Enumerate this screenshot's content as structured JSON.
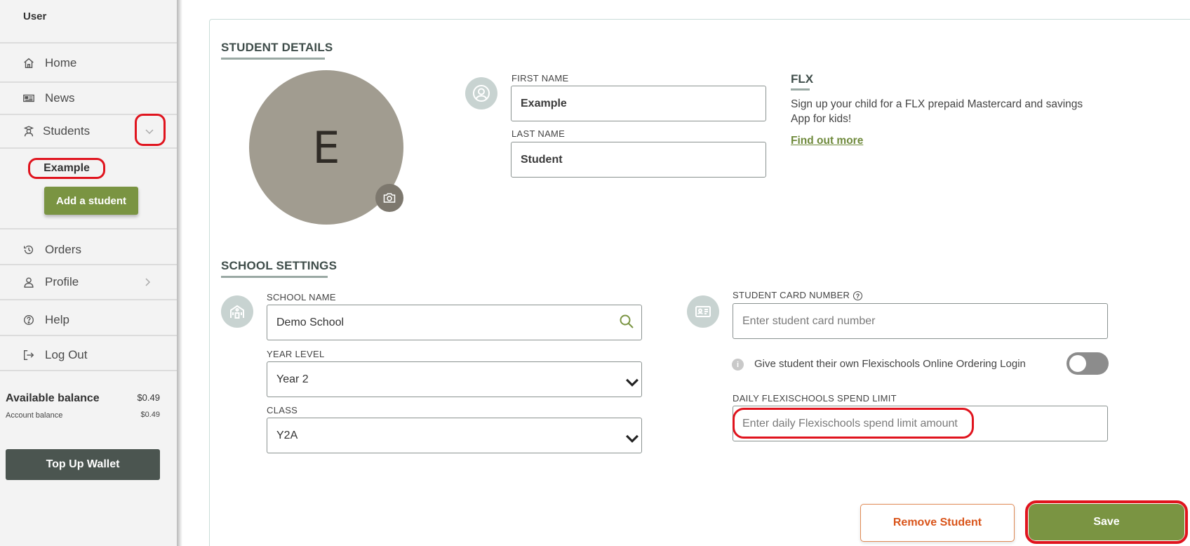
{
  "sidebar": {
    "user_label": "User",
    "items": {
      "home": "Home",
      "news": "News",
      "students": "Students",
      "orders": "Orders",
      "profile": "Profile",
      "help": "Help",
      "logout": "Log Out"
    },
    "student_entry": "Example",
    "add_student": "Add a student",
    "balance": {
      "available_label": "Available balance",
      "available_value": "$0.49",
      "account_label": "Account balance",
      "account_value": "$0.49"
    },
    "top_up": "Top Up Wallet"
  },
  "student_details": {
    "title": "STUDENT DETAILS",
    "avatar_initial": "E",
    "first_name_label": "FIRST NAME",
    "first_name_value": "Example",
    "last_name_label": "LAST NAME",
    "last_name_value": "Student"
  },
  "flx": {
    "title": "FLX",
    "description": "Sign up your child for a FLX prepaid Mastercard and savings App for kids!",
    "link": "Find out more"
  },
  "school_settings": {
    "title": "SCHOOL SETTINGS",
    "school_name_label": "SCHOOL NAME",
    "school_name_value": "Demo School",
    "year_level_label": "YEAR LEVEL",
    "year_level_value": "Year 2",
    "class_label": "CLASS",
    "class_value": "Y2A",
    "card_number_label": "STUDENT CARD NUMBER",
    "card_number_placeholder": "Enter student card number",
    "own_login_text": "Give student their own Flexischools Online Ordering Login",
    "own_login_enabled": false,
    "spend_limit_label": "DAILY FLEXISCHOOLS SPEND LIMIT",
    "spend_limit_placeholder": "Enter daily Flexischools spend limit amount"
  },
  "actions": {
    "remove": "Remove Student",
    "save": "Save"
  },
  "colors": {
    "accent_green": "#7a9442",
    "remove_orange": "#d9541a",
    "highlight_red": "#e0141e"
  }
}
